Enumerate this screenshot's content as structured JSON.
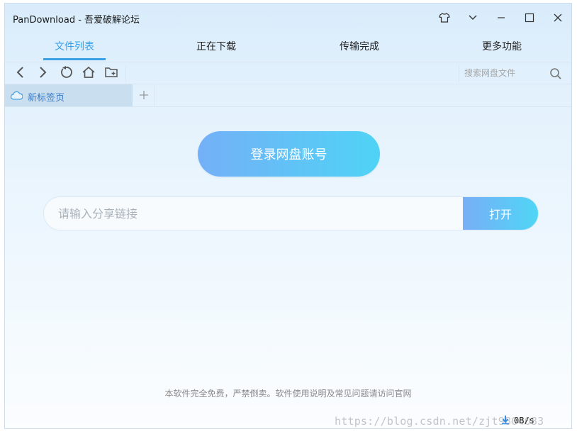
{
  "window": {
    "title": "PanDownload - 吾爱破解论坛",
    "controls": [
      "shirt-icon",
      "chevron-down-icon",
      "minimize-icon",
      "maximize-icon",
      "close-icon"
    ]
  },
  "nav_tabs": [
    {
      "label": "文件列表",
      "active": true
    },
    {
      "label": "正在下载",
      "active": false
    },
    {
      "label": "传输完成",
      "active": false
    },
    {
      "label": "更多功能",
      "active": false
    }
  ],
  "toolbar": {
    "buttons": [
      "back-icon",
      "forward-icon",
      "refresh-icon",
      "home-icon",
      "new-folder-icon"
    ],
    "search_placeholder": "搜索网盘文件"
  },
  "page_tabs": [
    {
      "label": "新标签页",
      "icon": "cloud-icon"
    }
  ],
  "main": {
    "login_label": "登录网盘账号",
    "share_placeholder": "请输入分享链接",
    "open_label": "打开",
    "footer": "本软件完全免费，严禁倒卖。软件使用说明及常见问题请访问官网"
  },
  "status": {
    "speed": "0B/s"
  },
  "watermark": "https://blog.csdn.net/zjt9804083",
  "colors": {
    "accent": "#3aa0e8",
    "button_gradient_start": "#74b0f7",
    "button_gradient_end": "#4fd3f5"
  }
}
